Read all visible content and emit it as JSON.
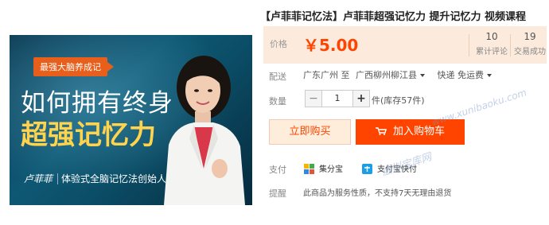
{
  "banner": {
    "tag": "最强大脑养成记",
    "line1": "如何拥有终身",
    "line2": "超强记忆力",
    "author": "卢菲菲",
    "subtitle": "体验式全脑记忆法创始人"
  },
  "product": {
    "title": "【卢菲菲记忆法】卢菲菲超强记忆力 提升记忆力 视频课程"
  },
  "price": {
    "label": "价格",
    "value": "￥5.00",
    "reviews_count": "10",
    "reviews_label": "累计评论",
    "sales_count": "19",
    "sales_label": "交易成功"
  },
  "shipping": {
    "label": "配送",
    "origin": "广东广州 至",
    "destination": "广西柳州柳江县",
    "method": "快递 免运费"
  },
  "quantity": {
    "label": "数量",
    "minus": "−",
    "value": "1",
    "plus": "+",
    "stock": "件(库存57件)"
  },
  "actions": {
    "buy_now": "立即购买",
    "add_to_cart": "加入购物车"
  },
  "payment": {
    "label": "支付",
    "method1": "集分宝",
    "method2": "支付宝快付"
  },
  "notice": {
    "label": "提醒",
    "text": "此商品为服务性质，不支持7天无理由退货"
  },
  "watermarks": {
    "url": "www.xunibaoku.com",
    "cn": "虚拟宝库网"
  },
  "colors": {
    "accent": "#ff4400",
    "price_bg": "#fcebdc",
    "banner_bg": "#0e5874",
    "highlight": "#ffd34c"
  }
}
